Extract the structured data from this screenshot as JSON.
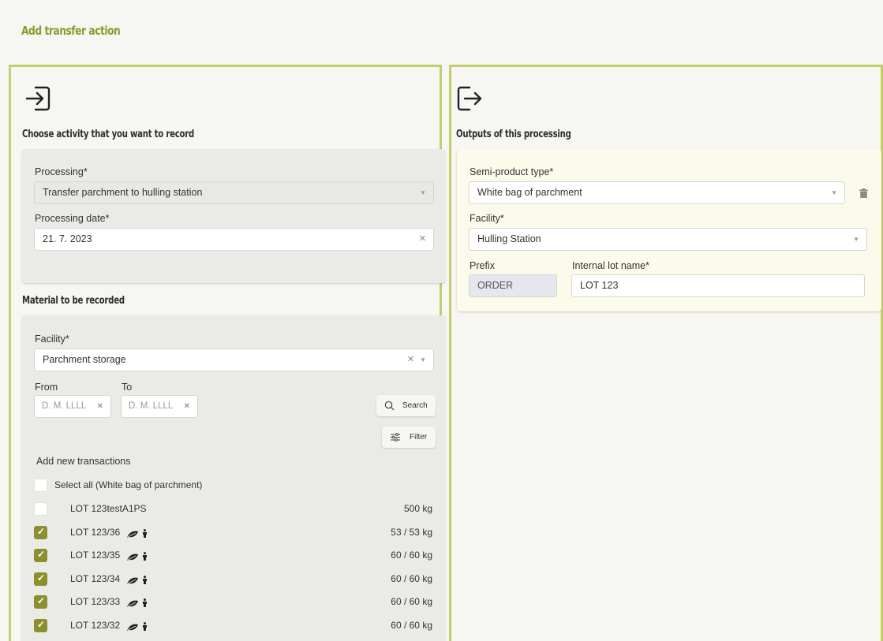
{
  "page": {
    "title": "Add transfer action"
  },
  "left": {
    "activity_title": "Choose activity that you want to record",
    "processing_label": "Processing*",
    "processing_value": "Transfer parchment to hulling station",
    "processing_date_label": "Processing date*",
    "processing_date_value": "21. 7. 2023",
    "material_title": "Material to be recorded",
    "facility_label": "Facility*",
    "facility_value": "Parchment storage",
    "from_label": "From",
    "to_label": "To",
    "from_placeholder": "D. M. LLLL",
    "to_placeholder": "D. M. LLLL",
    "search_label": "Search",
    "filter_label": "Filter",
    "add_new_label": "Add new transactions",
    "select_all_label": "Select all (White bag of parchment)",
    "transactions": [
      {
        "name": "LOT 123testA1PS",
        "qty": "500 kg",
        "checked": false,
        "icons": false
      },
      {
        "name": "LOT 123/36",
        "qty": "53 / 53 kg",
        "checked": true,
        "icons": true
      },
      {
        "name": "LOT 123/35",
        "qty": "60 / 60 kg",
        "checked": true,
        "icons": true
      },
      {
        "name": "LOT 123/34",
        "qty": "60 / 60 kg",
        "checked": true,
        "icons": true
      },
      {
        "name": "LOT 123/33",
        "qty": "60 / 60 kg",
        "checked": true,
        "icons": true
      },
      {
        "name": "LOT 123/32",
        "qty": "60 / 60 kg",
        "checked": true,
        "icons": true
      }
    ]
  },
  "right": {
    "outputs_title": "Outputs of this processing",
    "semi_product_label": "Semi-product type*",
    "semi_product_value": "White bag of parchment",
    "facility_label": "Facility*",
    "facility_value": "Hulling Station",
    "prefix_label": "Prefix",
    "prefix_value": "ORDER",
    "lot_name_label": "Internal lot name*",
    "lot_name_value": "LOT 123"
  },
  "colors": {
    "accent": "#8c9a2c",
    "panel_border": "#c4cd6a",
    "checkbox_checked": "#8d8f2f"
  }
}
